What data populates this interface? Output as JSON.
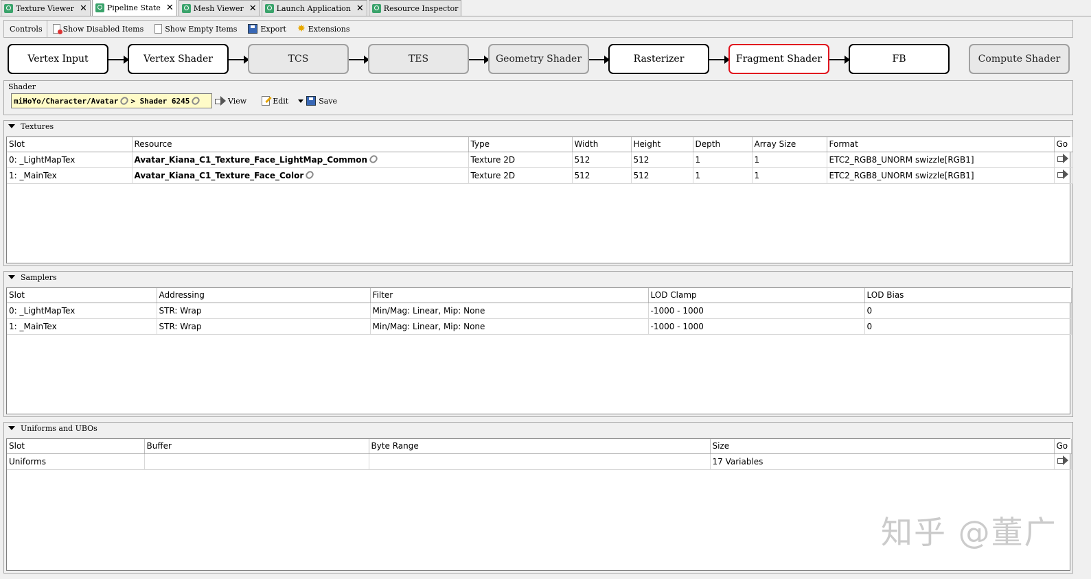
{
  "tabs": [
    {
      "label": "Texture Viewer",
      "active": false
    },
    {
      "label": "Pipeline State",
      "active": true
    },
    {
      "label": "Mesh Viewer",
      "active": false
    },
    {
      "label": "Launch Application",
      "active": false
    },
    {
      "label": "Resource Inspector",
      "active": false
    }
  ],
  "toolbar": {
    "controls_label": "Controls",
    "show_disabled": "Show Disabled Items",
    "show_empty": "Show Empty Items",
    "export": "Export",
    "extensions": "Extensions"
  },
  "pipeline": {
    "stages": [
      {
        "label": "Vertex Input",
        "state": "enabled"
      },
      {
        "label": "Vertex Shader",
        "state": "enabled"
      },
      {
        "label": "TCS",
        "state": "disabled"
      },
      {
        "label": "TES",
        "state": "disabled"
      },
      {
        "label": "Geometry Shader",
        "state": "disabled"
      },
      {
        "label": "Rasterizer",
        "state": "enabled"
      },
      {
        "label": "Fragment Shader",
        "state": "selected"
      },
      {
        "label": "FB",
        "state": "enabled"
      },
      {
        "label": "Compute Shader",
        "state": "disabled"
      }
    ]
  },
  "shader": {
    "group_title": "Shader",
    "path": "miHoYo/Character/Avatar",
    "name": "> Shader 6245",
    "view": "View",
    "edit": "Edit",
    "save": "Save"
  },
  "textures": {
    "title": "Textures",
    "columns": [
      "Slot",
      "Resource",
      "Type",
      "Width",
      "Height",
      "Depth",
      "Array Size",
      "Format",
      "Go"
    ],
    "rows": [
      {
        "slot": "0: _LightMapTex",
        "resource": "Avatar_Kiana_C1_Texture_Face_LightMap_Common",
        "type": "Texture 2D",
        "width": "512",
        "height": "512",
        "depth": "1",
        "array_size": "1",
        "format": "ETC2_RGB8_UNORM swizzle[RGB1]"
      },
      {
        "slot": "1: _MainTex",
        "resource": "Avatar_Kiana_C1_Texture_Face_Color",
        "type": "Texture 2D",
        "width": "512",
        "height": "512",
        "depth": "1",
        "array_size": "1",
        "format": "ETC2_RGB8_UNORM swizzle[RGB1]"
      }
    ]
  },
  "samplers": {
    "title": "Samplers",
    "columns": [
      "Slot",
      "Addressing",
      "Filter",
      "LOD Clamp",
      "LOD Bias"
    ],
    "rows": [
      {
        "slot": "0: _LightMapTex",
        "addressing": "STR: Wrap",
        "filter": "Min/Mag: Linear, Mip: None",
        "lod_clamp": "-1000 - 1000",
        "lod_bias": "0"
      },
      {
        "slot": "1: _MainTex",
        "addressing": "STR: Wrap",
        "filter": "Min/Mag: Linear, Mip: None",
        "lod_clamp": "-1000 - 1000",
        "lod_bias": "0"
      }
    ]
  },
  "uniforms": {
    "title": "Uniforms and UBOs",
    "columns": [
      "Slot",
      "Buffer",
      "Byte Range",
      "Size",
      "Go"
    ],
    "rows": [
      {
        "slot": "Uniforms",
        "buffer": "",
        "byte_range": "",
        "size": "17 Variables"
      }
    ]
  },
  "watermark": "知乎 @董广"
}
